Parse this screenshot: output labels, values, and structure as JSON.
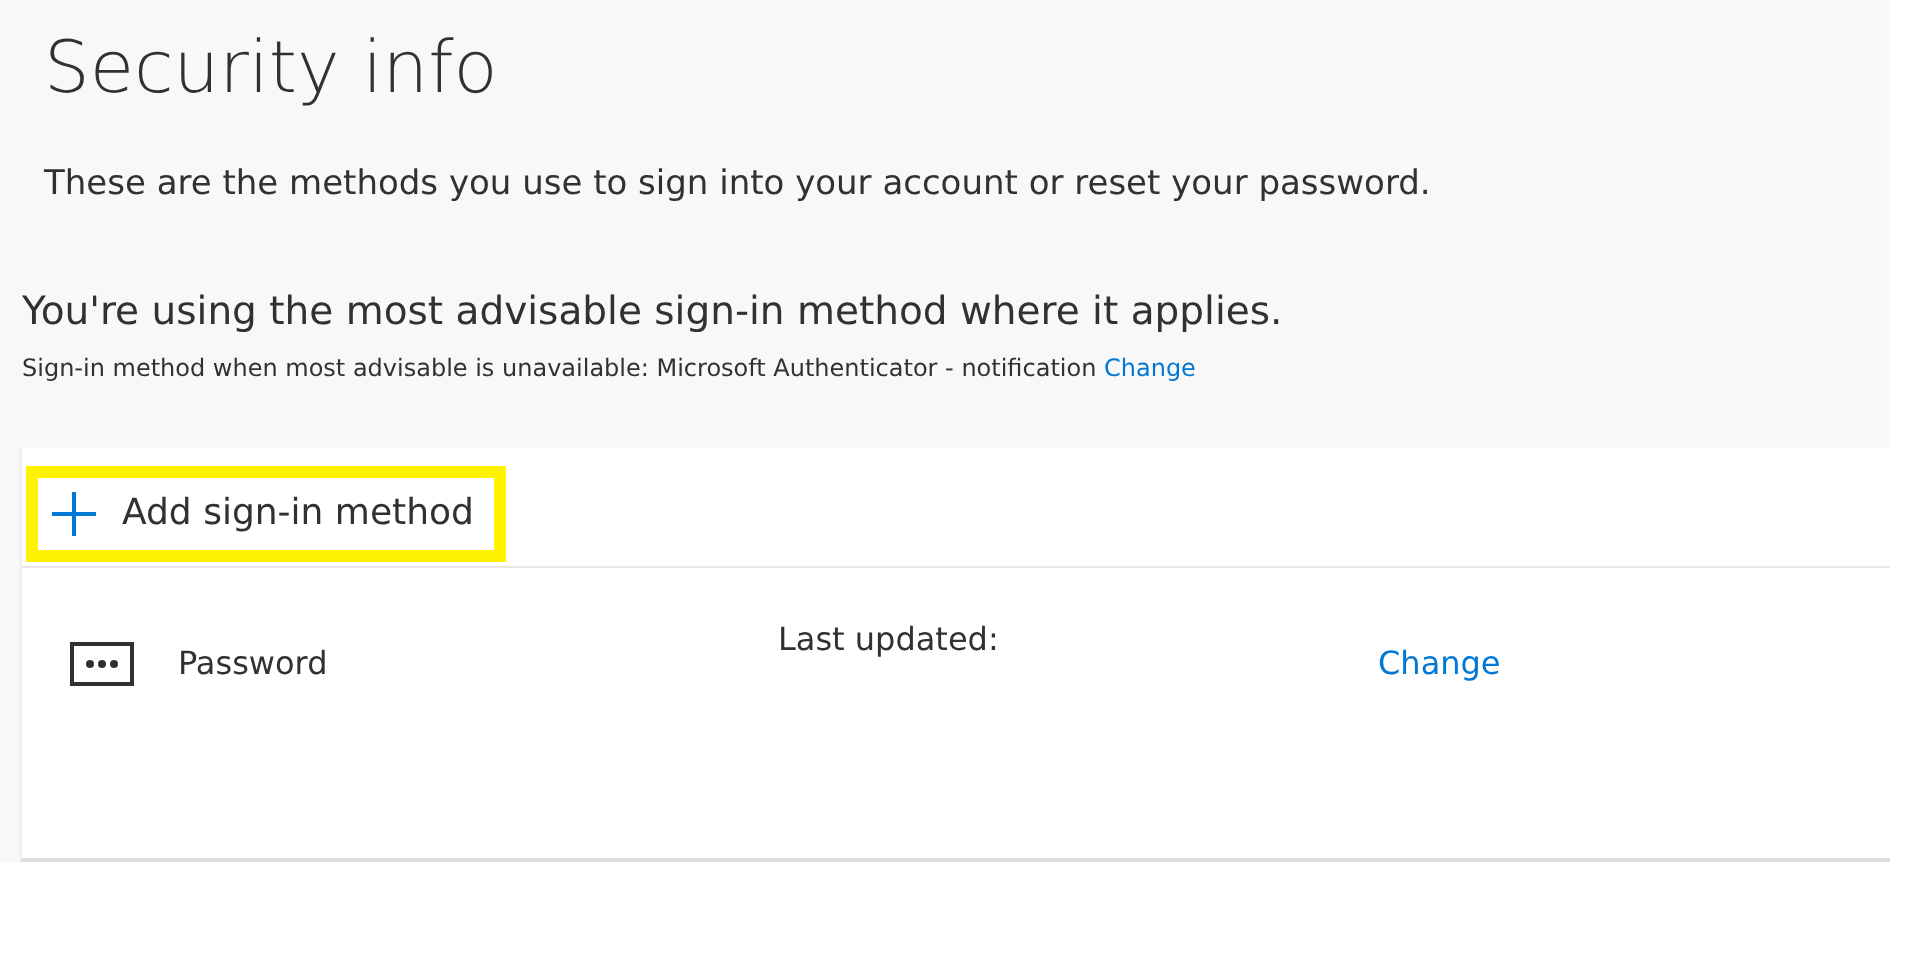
{
  "title": "Security info",
  "description": "These are the methods you use to sign into your account or reset your password.",
  "default_method": {
    "heading": "You're using the most advisable sign-in method where it applies.",
    "detail": "Sign-in method when most advisable is unavailable: Microsoft Authenticator - notification",
    "link": "Change"
  },
  "add_button": {
    "label": "Add sign-in method",
    "highlighted": true
  },
  "methods": [
    {
      "kind": "password",
      "name": "Password",
      "last_updated": "Last updated:",
      "action": "Change"
    }
  ]
}
